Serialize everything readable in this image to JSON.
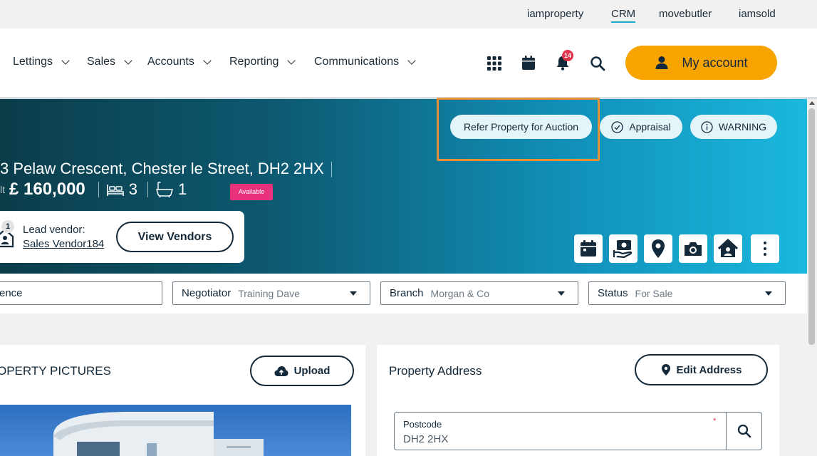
{
  "top_links": [
    "iamproperty",
    "CRM",
    "movebutler",
    "iamsold"
  ],
  "nav": {
    "items": [
      "Lettings",
      "Sales",
      "Accounts",
      "Reporting",
      "Communications"
    ],
    "notification_count": "14",
    "my_account_label": "My account",
    "icons": [
      "apps-grid-icon",
      "calendar-icon",
      "bell-icon",
      "search-icon",
      "user-icon"
    ]
  },
  "hero": {
    "buttons": {
      "refer": "Refer Property for Auction",
      "appraisal": "Appraisal",
      "warning": "WARNING"
    },
    "address": "3 Pelaw Crescent, Chester le Street, DH2 2HX",
    "price_prefix": "lt",
    "price": "£ 160,000",
    "bedrooms": "3",
    "bathrooms": "1",
    "status_badge": "Available",
    "vendor": {
      "count": "1",
      "label": "Lead vendor:",
      "name": "Sales Vendor184",
      "view_button": "View Vendors"
    },
    "action_icons": [
      "calendar-icon",
      "valuation-icon",
      "location-pin-icon",
      "camera-icon",
      "house-icon",
      "more-vertical-icon"
    ],
    "accent_colors": {
      "highlight": "#e6913a",
      "badge": "#e8327c",
      "cta": "#f8a400"
    }
  },
  "filters": {
    "reference_label": "ence",
    "negotiator": {
      "label": "Negotiator",
      "value": "Training Dave"
    },
    "branch": {
      "label": "Branch",
      "value": "Morgan & Co"
    },
    "status": {
      "label": "Status",
      "value": "For Sale"
    }
  },
  "pictures": {
    "title": "OPERTY PICTURES",
    "upload_label": "Upload"
  },
  "address_card": {
    "title": "Property Address",
    "edit_label": "Edit Address",
    "postcode_label": "Postcode",
    "postcode_value": "DH2 2HX",
    "required_marker": "*"
  }
}
